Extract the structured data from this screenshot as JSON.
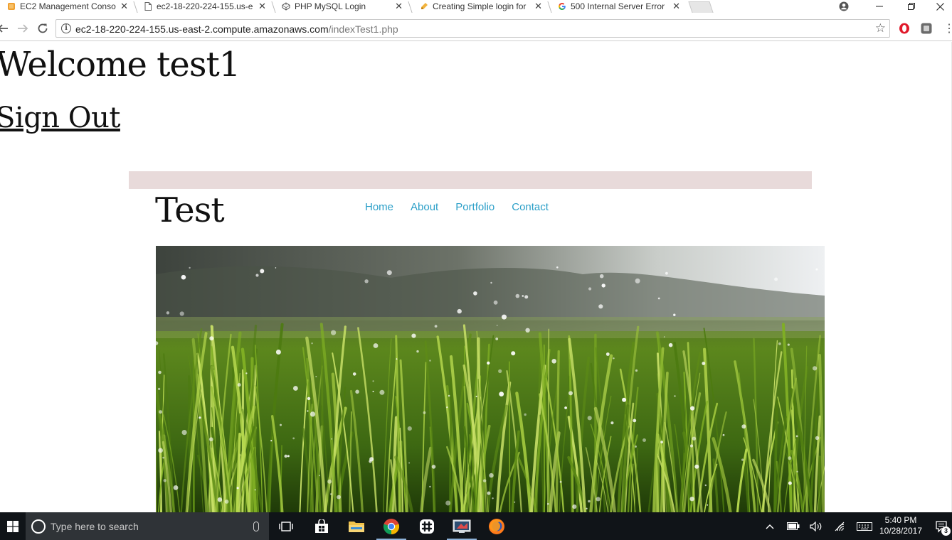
{
  "browser": {
    "tabs": [
      {
        "title": "EC2 Management Conso",
        "favicon": "aws-cube-icon"
      },
      {
        "title": "ec2-18-220-224-155.us-e",
        "favicon": "page-icon",
        "active": true
      },
      {
        "title": "PHP MySQL Login",
        "favicon": "codepen-icon"
      },
      {
        "title": "Creating Simple login for",
        "favicon": "pen-icon"
      },
      {
        "title": "500 Internal Server Error",
        "favicon": "google-icon"
      }
    ],
    "url_host": "ec2-18-220-224-155.us-east-2.compute.amazonaws.com",
    "url_path": "/indexTest1.php"
  },
  "page": {
    "welcome": "Welcome test1",
    "signout": "Sign Out",
    "brand": "Test",
    "nav": [
      "Home",
      "About",
      "Portfolio",
      "Contact"
    ],
    "hero_image": "dewy-grass-field-photo",
    "topbar_color": "#e8dada",
    "link_color": "#2b9fc8"
  },
  "taskbar": {
    "search_placeholder": "Type here to search",
    "time": "5:40 PM",
    "date": "10/28/2017",
    "notifications": "3"
  }
}
